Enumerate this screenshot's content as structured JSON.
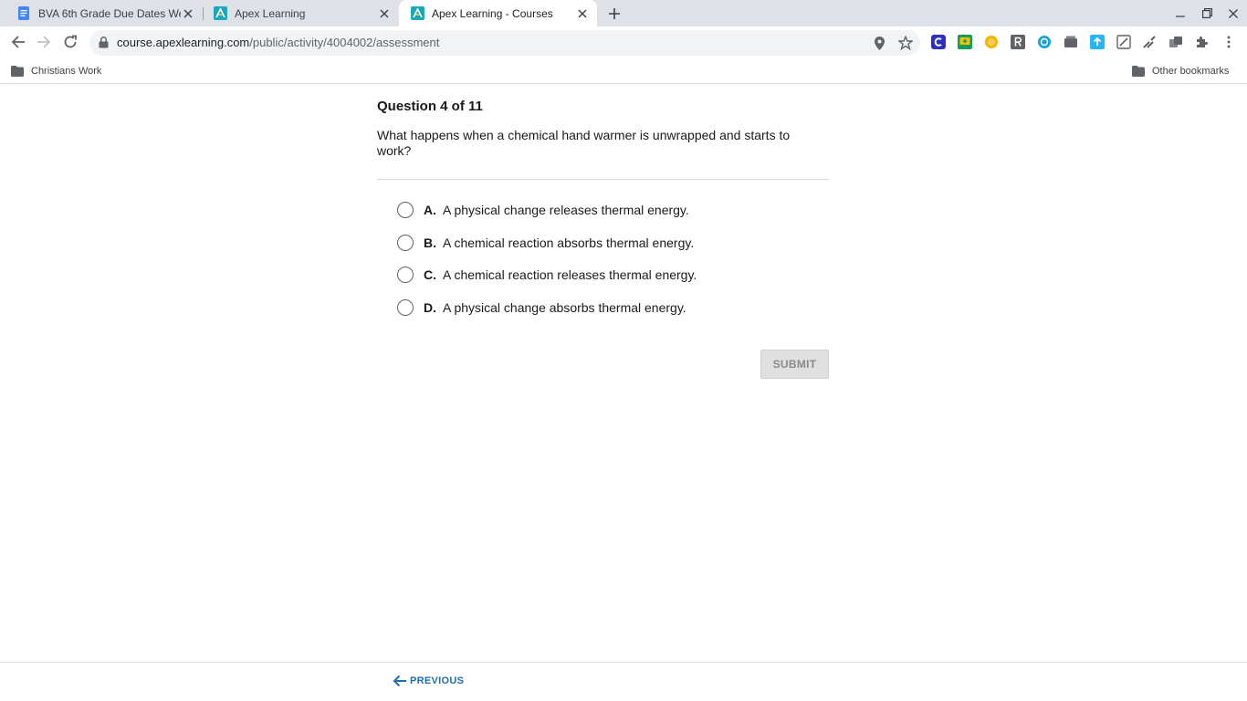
{
  "browser": {
    "tabs": [
      {
        "title": "BVA 6th Grade Due Dates Week",
        "favicon": "docs-icon",
        "active": false
      },
      {
        "title": "Apex Learning",
        "favicon": "apex-icon",
        "active": false
      },
      {
        "title": "Apex Learning - Courses",
        "favicon": "apex-icon",
        "active": true
      }
    ],
    "address": {
      "host": "course.apexlearning.com",
      "path": "/public/activity/4004002/assessment"
    },
    "bookmarks": {
      "left_folder": "Christians Work",
      "right_folder": "Other bookmarks"
    }
  },
  "question": {
    "header": "Question 4 of 11",
    "text": "What happens when a chemical hand warmer is unwrapped and starts to work?",
    "options": [
      {
        "letter": "A.",
        "text": "A physical change releases thermal energy."
      },
      {
        "letter": "B.",
        "text": "A chemical reaction absorbs thermal energy."
      },
      {
        "letter": "C.",
        "text": "A chemical reaction releases thermal energy."
      },
      {
        "letter": "D.",
        "text": "A physical change absorbs thermal energy."
      }
    ],
    "submit_label": "SUBMIT"
  },
  "footer": {
    "previous_label": "PREVIOUS"
  },
  "colors": {
    "accent_link": "#1f6fae",
    "tabstrip_bg": "#dee1e6",
    "submit_disabled_bg": "#e0e0e0"
  }
}
